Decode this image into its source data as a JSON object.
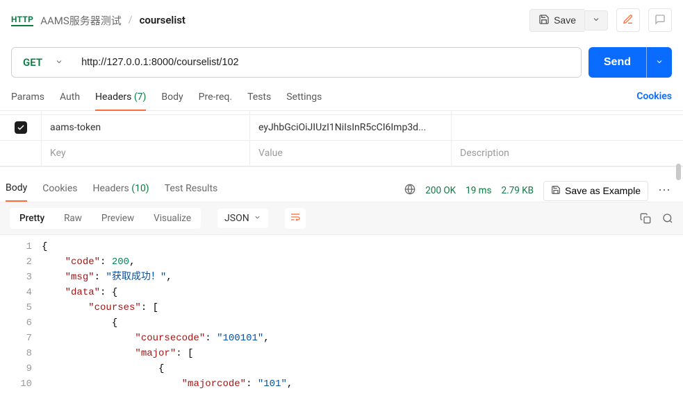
{
  "breadcrumb": {
    "badge": "HTTP",
    "collection": "AAMS服务器测试",
    "request_name": "courselist"
  },
  "toolbar": {
    "save_label": "Save"
  },
  "request": {
    "method": "GET",
    "url": "http://127.0.0.1:8000/courselist/102",
    "send_label": "Send"
  },
  "req_tabs": {
    "params": "Params",
    "auth": "Auth",
    "headers": "Headers",
    "headers_count": "(7)",
    "body": "Body",
    "prereq": "Pre-req.",
    "tests": "Tests",
    "settings": "Settings",
    "cookies": "Cookies"
  },
  "headers_table": {
    "rows": [
      {
        "enabled": true,
        "key": "aams-token",
        "value": "eyJhbGciOiJIUzI1NiIsInR5cCI6Imp3d..."
      }
    ],
    "placeholders": {
      "key": "Key",
      "value": "Value",
      "description": "Description"
    }
  },
  "resp_tabs": {
    "body": "Body",
    "cookies": "Cookies",
    "headers": "Headers",
    "headers_count": "(10)",
    "test_results": "Test Results"
  },
  "status": {
    "code": "200 OK",
    "time": "19 ms",
    "size": "2.79 KB",
    "save_example": "Save as Example"
  },
  "viewbar": {
    "pretty": "Pretty",
    "raw": "Raw",
    "preview": "Preview",
    "visualize": "Visualize",
    "format": "JSON"
  },
  "response_body": {
    "lines": [
      "{",
      "    \"code\": 200,",
      "    \"msg\": \"获取成功！\",",
      "    \"data\": {",
      "        \"courses\": [",
      "            {",
      "                \"coursecode\": \"100101\",",
      "                \"major\": [",
      "                    {",
      "                        \"majorcode\": \"101\","
    ]
  }
}
